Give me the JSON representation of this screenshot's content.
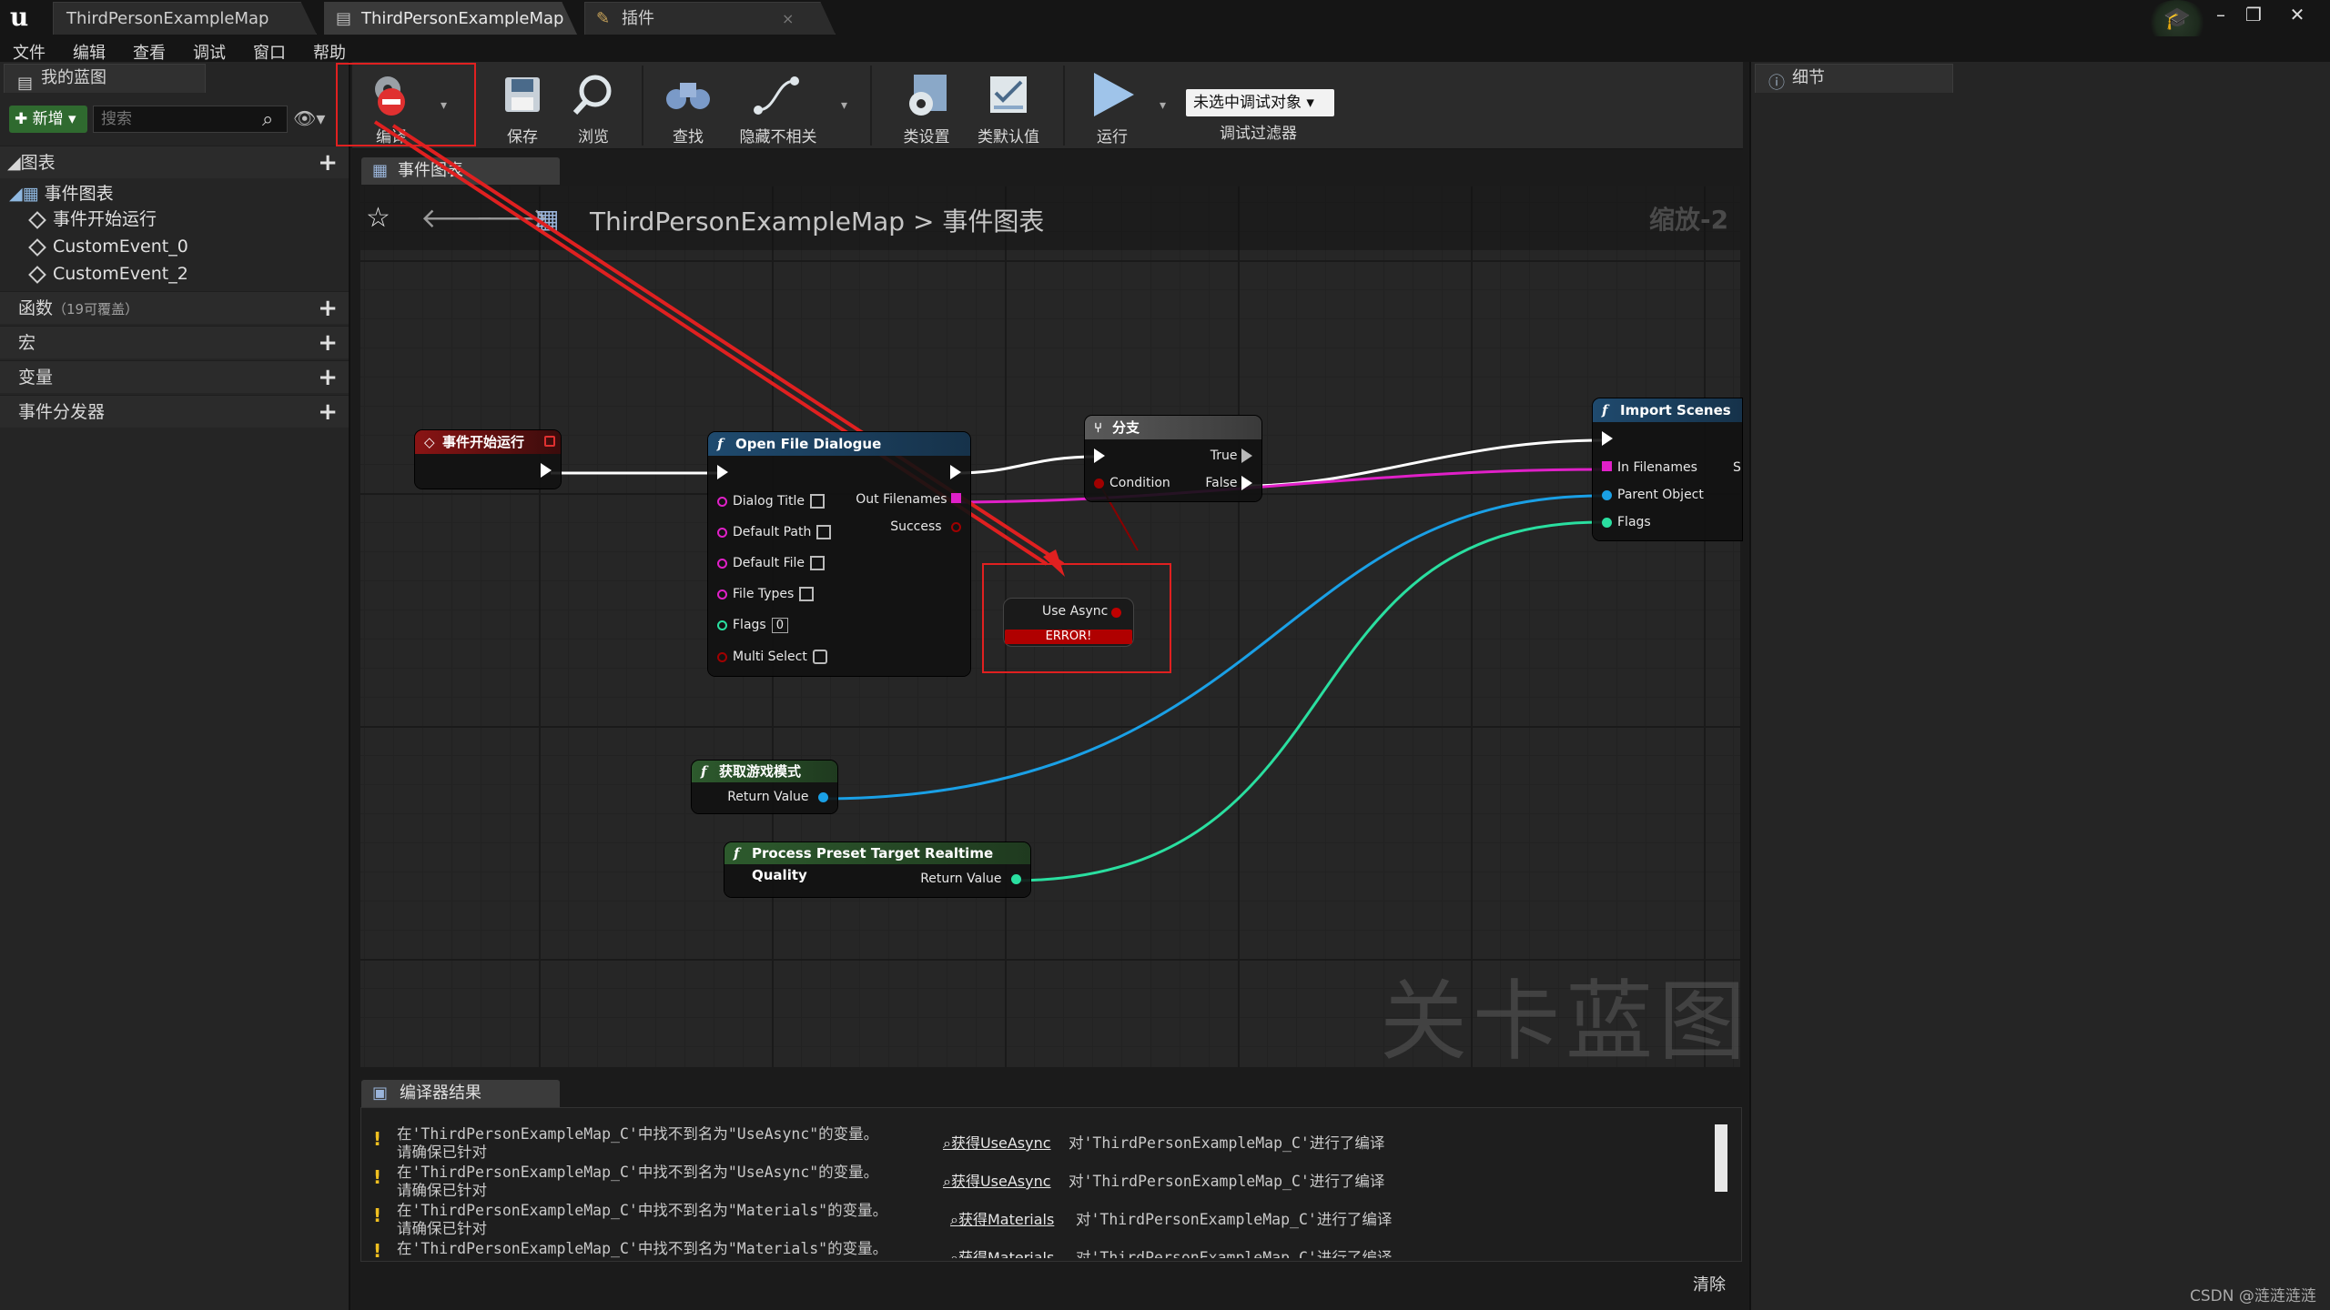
{
  "window": {
    "tabs": [
      {
        "label": "ThirdPersonExampleMap",
        "active": false
      },
      {
        "label": "ThirdPersonExampleMap",
        "active": true
      },
      {
        "label": "插件",
        "active": false
      }
    ]
  },
  "menu": [
    "文件",
    "编辑",
    "查看",
    "调试",
    "窗口",
    "帮助"
  ],
  "left_panel": {
    "tab_label": "我的蓝图",
    "add_label": "新增",
    "search_placeholder": "搜索",
    "sections": {
      "graphs": "图表",
      "functions": "函数",
      "functions_sub": "（19可覆盖）",
      "macros": "宏",
      "variables": "变量",
      "dispatchers": "事件分发器"
    },
    "event_graph_label": "事件图表",
    "events": [
      "事件开始运行",
      "CustomEvent_0",
      "CustomEvent_2"
    ]
  },
  "toolbar": {
    "compile": "编译",
    "save": "保存",
    "browse": "浏览",
    "find": "查找",
    "hide_unrelated": "隐藏不相关",
    "class_settings": "类设置",
    "class_defaults": "类默认值",
    "play": "运行",
    "debug_object": "未选中调试对象",
    "debug_filter": "调试过滤器"
  },
  "details_panel": {
    "tab_label": "细节"
  },
  "graph": {
    "tab_label": "事件图表",
    "breadcrumb_root": "ThirdPersonExampleMap",
    "breadcrumb_sep": ">",
    "breadcrumb_leaf": "事件图表",
    "zoom": "缩放-2",
    "watermark": "关卡蓝图",
    "nodes": {
      "begin_play": "事件开始运行",
      "open_file": {
        "title": "Open File Dialogue",
        "inputs": [
          "Dialog Title",
          "Default Path",
          "Default File",
          "File Types",
          "Flags",
          "Multi Select"
        ],
        "flags_value": "0",
        "outputs": [
          "Out Filenames",
          "Success"
        ]
      },
      "branch": {
        "title": "分支",
        "condition": "Condition",
        "true_label": "True",
        "false_label": "False"
      },
      "import_scenes": {
        "title": "Import Scenes",
        "inputs": [
          "In Filenames",
          "Parent Object",
          "Flags"
        ],
        "clipped": "S"
      },
      "use_async": {
        "label": "Use Async",
        "error": "ERROR!"
      },
      "get_game_mode": {
        "title": "获取游戏模式",
        "output": "Return Value"
      },
      "process_preset": {
        "title": "Process Preset Target Realtime Quality",
        "output": "Return Value"
      }
    }
  },
  "compiler": {
    "tab_label": "编译器结果",
    "rows": [
      {
        "msg": "在'ThirdPersonExampleMap_C'中找不到名为\"UseAsync\"的变量。",
        "hint": "请确保已针对",
        "link": "获得UseAsync",
        "suffix": "对'ThirdPersonExampleMap_C'进行了编译"
      },
      {
        "msg": "在'ThirdPersonExampleMap_C'中找不到名为\"UseAsync\"的变量。",
        "hint": "请确保已针对",
        "link": "获得UseAsync",
        "suffix": "对'ThirdPersonExampleMap_C'进行了编译"
      },
      {
        "msg": "在'ThirdPersonExampleMap_C'中找不到名为\"Materials\"的变量。",
        "hint": "请确保已针对",
        "link": "获得Materials",
        "suffix": "对'ThirdPersonExampleMap_C'进行了编译"
      },
      {
        "msg": "在'ThirdPersonExampleMap_C'中找不到名为\"Materials\"的变量。",
        "hint": "",
        "link": "获得Materials",
        "suffix": "对'ThirdPersonExampleMap_C'进行了编译"
      }
    ],
    "clear": "清除"
  },
  "credit": "CSDN @涟涟涟涟",
  "colors": {
    "accent_red": "#e02020",
    "exec_wire": "#ffffff",
    "string_pin": "#e020c8",
    "object_pin": "#1aa0e6",
    "int_pin": "#2adfa0",
    "bool_pin": "#a00000",
    "function_header": "#1f4a6e",
    "event_header": "#7a1010"
  }
}
